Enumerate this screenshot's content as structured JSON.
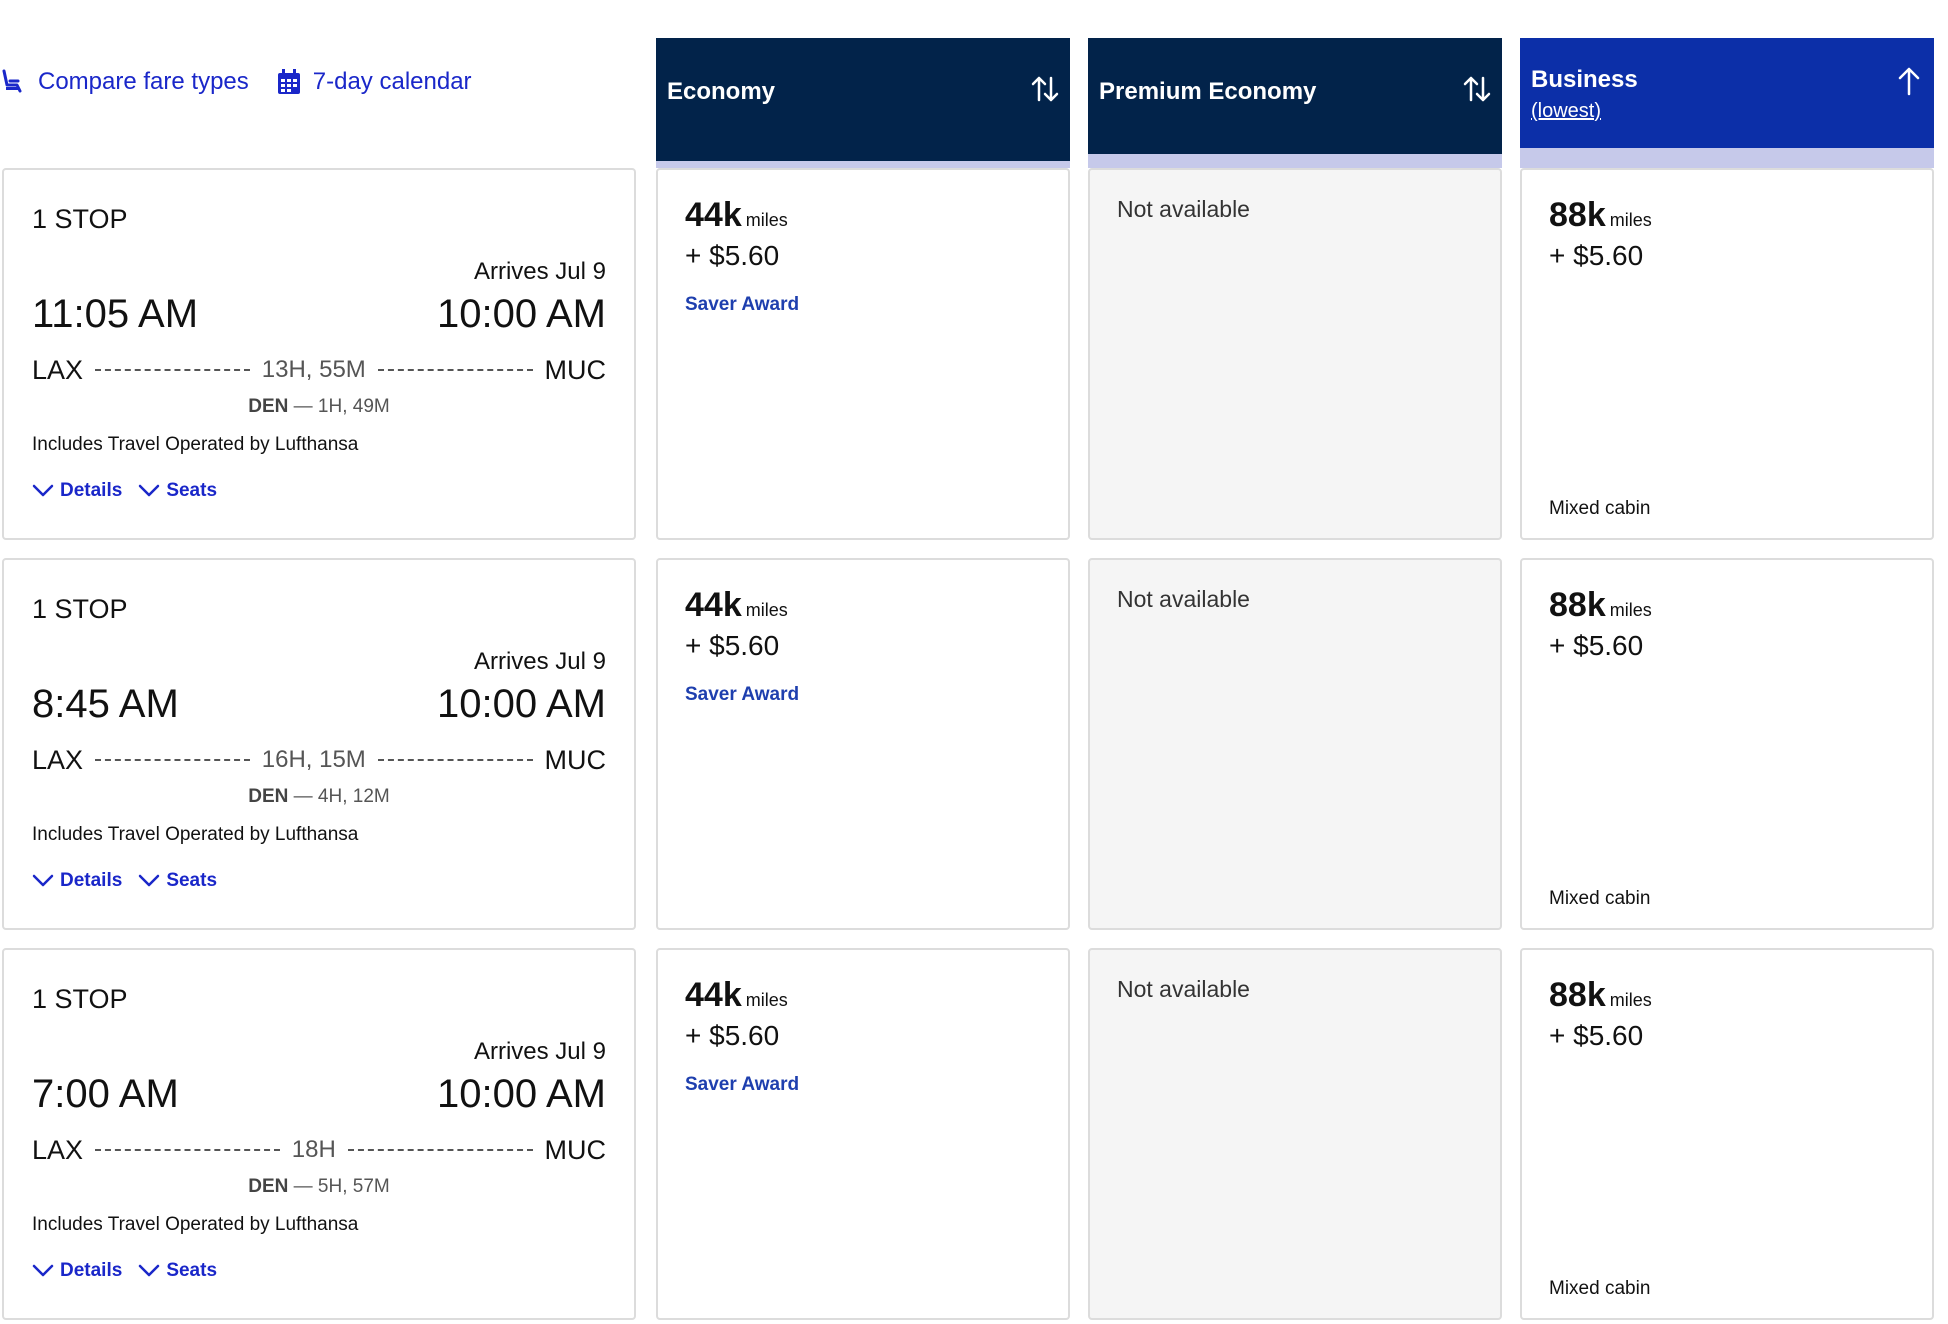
{
  "toolbar": {
    "compare_label": "Compare fare types",
    "compare_icon": "seat-icon",
    "calendar_label": "7-day calendar",
    "calendar_icon": "calendar-icon"
  },
  "columns": [
    {
      "title": "Economy",
      "subtitle": "",
      "sort_icon": "sort-up-down-icon",
      "bg": "#02234a"
    },
    {
      "title": "Premium Economy",
      "subtitle": "",
      "sort_icon": "sort-up-down-icon",
      "bg": "#02234a"
    },
    {
      "title": "Business",
      "subtitle": "(lowest)",
      "sort_icon": "arrow-up-icon",
      "bg": "#0c2fa8"
    }
  ],
  "flights": [
    {
      "stops": "1 STOP",
      "arrives": "Arrives Jul 9",
      "depart_time": "11:05 AM",
      "arrive_time": "10:00 AM",
      "origin": "LAX",
      "destination": "MUC",
      "duration": "13H, 55M",
      "layover_airport": "DEN",
      "layover_duration": "— 1H, 49M",
      "operated": "Includes Travel Operated by Lufthansa",
      "details_label": "Details",
      "seats_label": "Seats",
      "economy": {
        "miles": "44k",
        "miles_unit": "miles",
        "tax": "+ $5.60",
        "award": "Saver Award"
      },
      "premium": {
        "text": "Not available"
      },
      "business": {
        "miles": "88k",
        "miles_unit": "miles",
        "tax": "+ $5.60",
        "note": "Mixed cabin"
      }
    },
    {
      "stops": "1 STOP",
      "arrives": "Arrives Jul 9",
      "depart_time": "8:45 AM",
      "arrive_time": "10:00 AM",
      "origin": "LAX",
      "destination": "MUC",
      "duration": "16H, 15M",
      "layover_airport": "DEN",
      "layover_duration": "— 4H, 12M",
      "operated": "Includes Travel Operated by Lufthansa",
      "details_label": "Details",
      "seats_label": "Seats",
      "economy": {
        "miles": "44k",
        "miles_unit": "miles",
        "tax": "+ $5.60",
        "award": "Saver Award"
      },
      "premium": {
        "text": "Not available"
      },
      "business": {
        "miles": "88k",
        "miles_unit": "miles",
        "tax": "+ $5.60",
        "note": "Mixed cabin"
      }
    },
    {
      "stops": "1 STOP",
      "arrives": "Arrives Jul 9",
      "depart_time": "7:00 AM",
      "arrive_time": "10:00 AM",
      "origin": "LAX",
      "destination": "MUC",
      "duration": "18H",
      "layover_airport": "DEN",
      "layover_duration": "— 5H, 57M",
      "operated": "Includes Travel Operated by Lufthansa",
      "details_label": "Details",
      "seats_label": "Seats",
      "economy": {
        "miles": "44k",
        "miles_unit": "miles",
        "tax": "+ $5.60",
        "award": "Saver Award"
      },
      "premium": {
        "text": "Not available"
      },
      "business": {
        "miles": "88k",
        "miles_unit": "miles",
        "tax": "+ $5.60",
        "note": "Mixed cabin"
      }
    }
  ],
  "colors": {
    "link": "#1a27c9",
    "award": "#1e3fae",
    "header_dark": "#02234a",
    "header_selected": "#0c2fa8",
    "header_bar": "#c6c9ea",
    "unavailable_bg": "#f5f5f5"
  }
}
